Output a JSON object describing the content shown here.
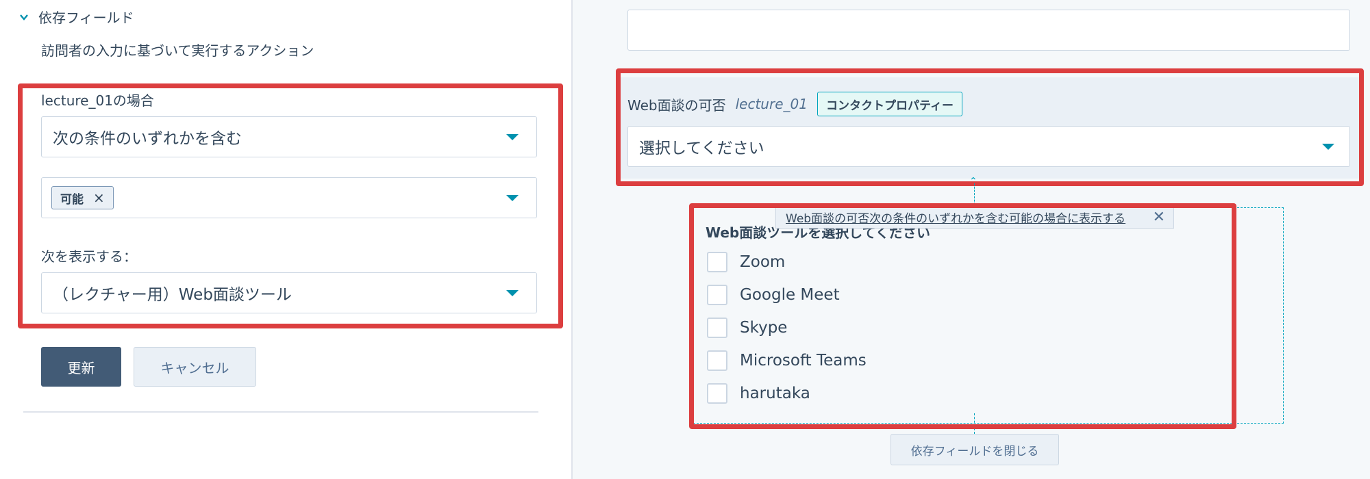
{
  "left": {
    "section_title": "依存フィールド",
    "description": "訪問者の入力に基づいて実行するアクション",
    "condition_label": "lecture_01の場合",
    "operator_select": "次の条件のいずれかを含む",
    "value_tag": "可能",
    "value_tag_remove": "×",
    "show_label": "次を表示する：",
    "show_select": "（レクチャー用）Web面談ツール",
    "update_button": "更新",
    "cancel_button": "キャンセル"
  },
  "right": {
    "field_label": "Web面談の可否",
    "field_property": "lecture_01",
    "contact_property_tag": "コンタクトプロパティー",
    "field_select": "選択してください",
    "dependent_tooltip": "Web面談の可否次の条件のいずれかを含む可能の場合に表示する",
    "tooltip_close": "✕",
    "group_label": "Web面談ツールを選択してください",
    "options": [
      "Zoom",
      "Google Meet",
      "Skype",
      "Microsoft Teams",
      "harutaka"
    ],
    "close_dependent_button": "依存フィールドを閉じる"
  },
  "colors": {
    "highlight": "#dc3e3f",
    "accent": "#0091ae",
    "primary_button": "#425b76"
  },
  "icons": {
    "section_toggle": "chevron-down-icon",
    "select_caret": "caret-down-icon"
  }
}
